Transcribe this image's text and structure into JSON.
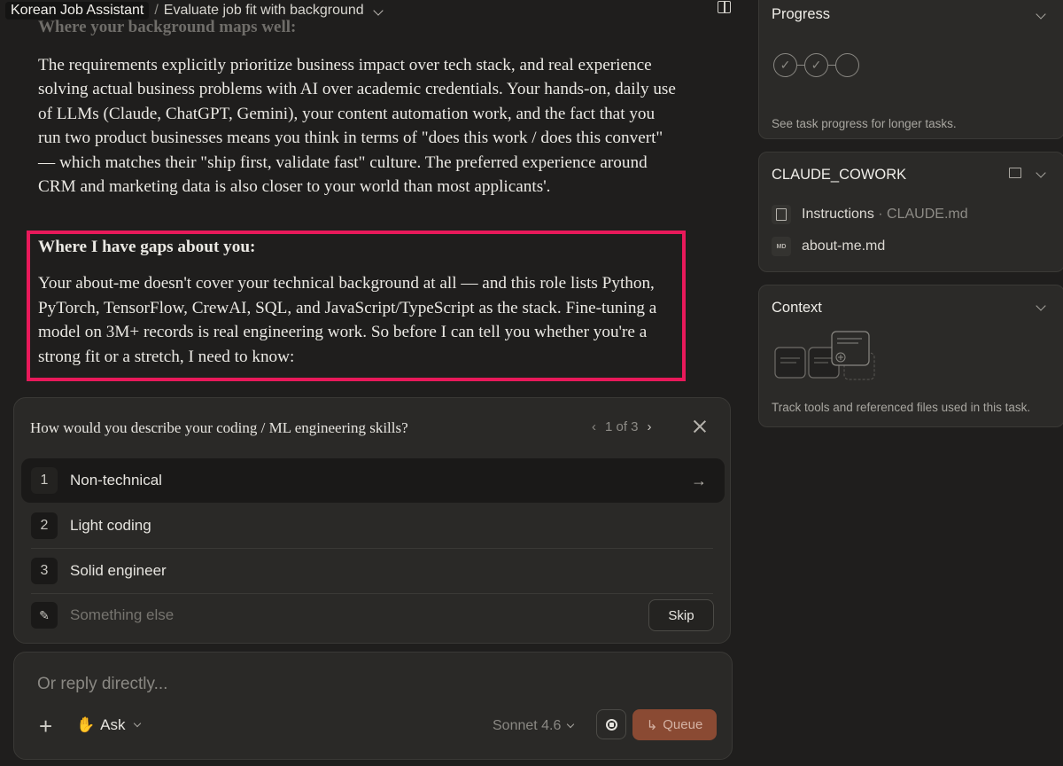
{
  "header": {
    "project": "Korean Job Assistant",
    "separator": "/",
    "task": "Evaluate job fit with background"
  },
  "message": {
    "faded_heading": "Where your background maps well:",
    "maps_well": "The requirements explicitly prioritize business impact over tech stack, and real experience solving actual business problems with AI over academic credentials. Your hands-on, daily use of LLMs (Claude, ChatGPT, Gemini), your content automation work, and the fact that you run two product businesses means you think in terms of \"does this work / does this convert\" — which matches their \"ship first, validate fast\" culture. The preferred experience around CRM and marketing data is also closer to your world than most applicants'.",
    "gaps_heading": "Where I have gaps about you:",
    "gaps_body": "Your about-me doesn't cover your technical background at all — and this role lists Python, PyTorch, TensorFlow, CrewAI, SQL, and JavaScript/TypeScript as the stack. Fine-tuning a model on 3M+ records is real engineering work. So before I can tell you whether you're a strong fit or a stretch, I need to know:",
    "highlight_color": "#e8195a"
  },
  "question": {
    "title": "How would you describe your coding / ML engineering skills?",
    "pager": "1 of 3",
    "options": [
      {
        "num": "1",
        "label": "Non-technical"
      },
      {
        "num": "2",
        "label": "Light coding"
      },
      {
        "num": "3",
        "label": "Solid engineer"
      }
    ],
    "other_placeholder": "Something else",
    "skip_label": "Skip"
  },
  "composer": {
    "placeholder": "Or reply directly...",
    "mode_label": "Ask",
    "model_label": "Sonnet 4.6",
    "queue_label": "Queue",
    "queue_color": "#8a4a33"
  },
  "progress": {
    "title": "Progress",
    "caption": "See task progress for longer tasks.",
    "steps_completed": 2,
    "steps_total": 3
  },
  "workspace": {
    "title": "CLAUDE_COWORK",
    "files": [
      {
        "name": "Instructions",
        "meta": "· CLAUDE.md",
        "icon": "document-icon"
      },
      {
        "name": "about-me.md",
        "meta": "",
        "icon": "markdown-file-icon"
      }
    ]
  },
  "context": {
    "title": "Context",
    "caption": "Track tools and referenced files used in this task."
  }
}
